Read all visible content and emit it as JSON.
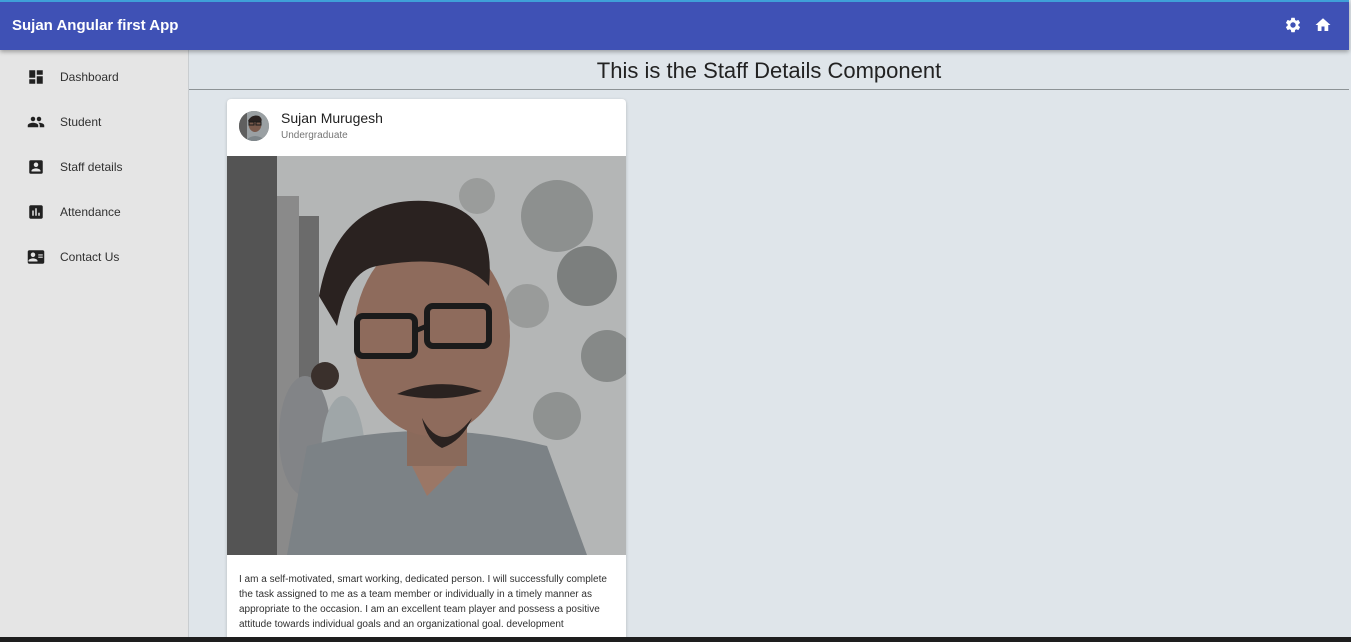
{
  "app": {
    "title": "Sujan Angular first App",
    "accent_color": "#3f51b5",
    "actions": [
      {
        "icon": "gear-icon"
      },
      {
        "icon": "home-icon"
      }
    ]
  },
  "sidebar": {
    "items": [
      {
        "label": "Dashboard",
        "icon": "dashboard-icon"
      },
      {
        "label": "Student",
        "icon": "people-icon"
      },
      {
        "label": "Staff details",
        "icon": "contact-card-icon"
      },
      {
        "label": "Attendance",
        "icon": "bar-chart-icon"
      },
      {
        "label": "Contact Us",
        "icon": "contact-mail-icon"
      }
    ]
  },
  "main": {
    "title": "This is the Staff Details Component",
    "card": {
      "name": "Sujan Murugesh",
      "subtitle": "Undergraduate",
      "description": "I am a self-motivated, smart working, dedicated person. I will successfully complete the task assigned to me as a team member or individually in a timely manner as appropriate to the occasion. I am an excellent team player and possess a positive attitude towards individual goals and an organizational goal. development"
    }
  }
}
